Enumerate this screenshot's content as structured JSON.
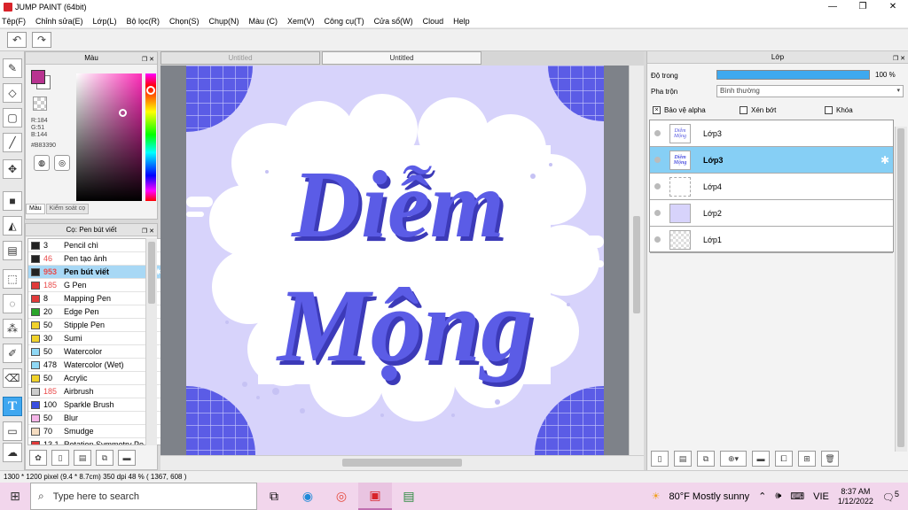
{
  "window": {
    "title": "JUMP PAINT (64bit)",
    "minimize": "—",
    "maximize": "❐",
    "close": "✕"
  },
  "menu": [
    "Tệp(F)",
    "Chỉnh sửa(E)",
    "Lớp(L)",
    "Bộ lọc(R)",
    "Chọn(S)",
    "Chụp(N)",
    "Màu (C)",
    "Xem(V)",
    "Công cụ(T)",
    "Cửa sổ(W)",
    "Cloud",
    "Help"
  ],
  "toolbar": {
    "undo_icon": "undo-arrow",
    "redo_icon": "redo-arrow"
  },
  "color_panel": {
    "title": "Màu",
    "fg_color": "#B83390",
    "r": "R:184",
    "g": "G:51",
    "b": "B:144",
    "hex": "#B83390",
    "tabs": [
      "Màu",
      "Kiểm soát cọ"
    ]
  },
  "brush_panel": {
    "title": "Cọ: Pen bút viết",
    "items": [
      {
        "size": "3",
        "name": "Pencil chì",
        "color": "#222222",
        "red": false
      },
      {
        "size": "46",
        "name": "Pen tạo ảnh",
        "color": "#222222",
        "red": true
      },
      {
        "size": "953",
        "name": "Pen bút viết",
        "color": "#222222",
        "red": true,
        "selected": true
      },
      {
        "size": "185",
        "name": "G Pen",
        "color": "#e03a3a",
        "red": true
      },
      {
        "size": "8",
        "name": "Mapping Pen",
        "color": "#e03a3a",
        "red": false
      },
      {
        "size": "20",
        "name": "Edge Pen",
        "color": "#2aa52a",
        "red": false
      },
      {
        "size": "50",
        "name": "Stipple Pen",
        "color": "#f0d22a",
        "red": false
      },
      {
        "size": "30",
        "name": "Sumi",
        "color": "#f0d22a",
        "red": false
      },
      {
        "size": "50",
        "name": "Watercolor",
        "color": "#8fd8f5",
        "red": false
      },
      {
        "size": "478",
        "name": "Watercolor (Wet)",
        "color": "#8fd8f5",
        "red": false
      },
      {
        "size": "50",
        "name": "Acrylic",
        "color": "#f0d22a",
        "red": false
      },
      {
        "size": "185",
        "name": "Airbrush",
        "color": "#cccccc",
        "red": true
      },
      {
        "size": "100",
        "name": "Sparkle Brush",
        "color": "#3a4fe0",
        "red": false
      },
      {
        "size": "50",
        "name": "Blur",
        "color": "#f5b5e8",
        "red": false
      },
      {
        "size": "70",
        "name": "Smudge",
        "color": "#f5dcc0",
        "red": false
      },
      {
        "size": "13.1",
        "name": "Rotation Symmetry Pe",
        "color": "#e03a3a",
        "red": false
      }
    ]
  },
  "tabs": [
    {
      "label": "Untitled",
      "active": false
    },
    {
      "label": "Untitled",
      "active": true
    }
  ],
  "artwork": {
    "line1": "Diễm",
    "line2": "Mộng",
    "accent": "#5b5ce6",
    "bg": "#d7d3fb"
  },
  "layer_panel": {
    "title": "Lớp",
    "opacity_label": "Độ trong",
    "opacity_value": "100 %",
    "opacity": 1.0,
    "blend_label": "Pha trộn",
    "blend_value": "Bình thường",
    "protect_alpha": "Bảo vệ alpha",
    "clipping": "Xén bớt",
    "lock": "Khóa",
    "layers": [
      {
        "name": "Lớp3",
        "selected": false,
        "thumb": "art"
      },
      {
        "name": "Lớp3",
        "selected": true,
        "thumb": "art"
      },
      {
        "name": "Lớp4",
        "selected": false,
        "thumb": "white"
      },
      {
        "name": "Lớp2",
        "selected": false,
        "thumb": "lavender"
      },
      {
        "name": "Lớp1",
        "selected": false,
        "thumb": "checker"
      }
    ]
  },
  "status": "1300 * 1200 pixel   (9.4 * 8.7cm)   350 dpi   48 %   ( 1367, 608 )",
  "taskbar": {
    "search_placeholder": "Type here to search",
    "weather": "80°F  Mostly sunny",
    "lang": "VIE",
    "time": "8:37 AM",
    "date": "1/12/2022",
    "notif": "5"
  }
}
